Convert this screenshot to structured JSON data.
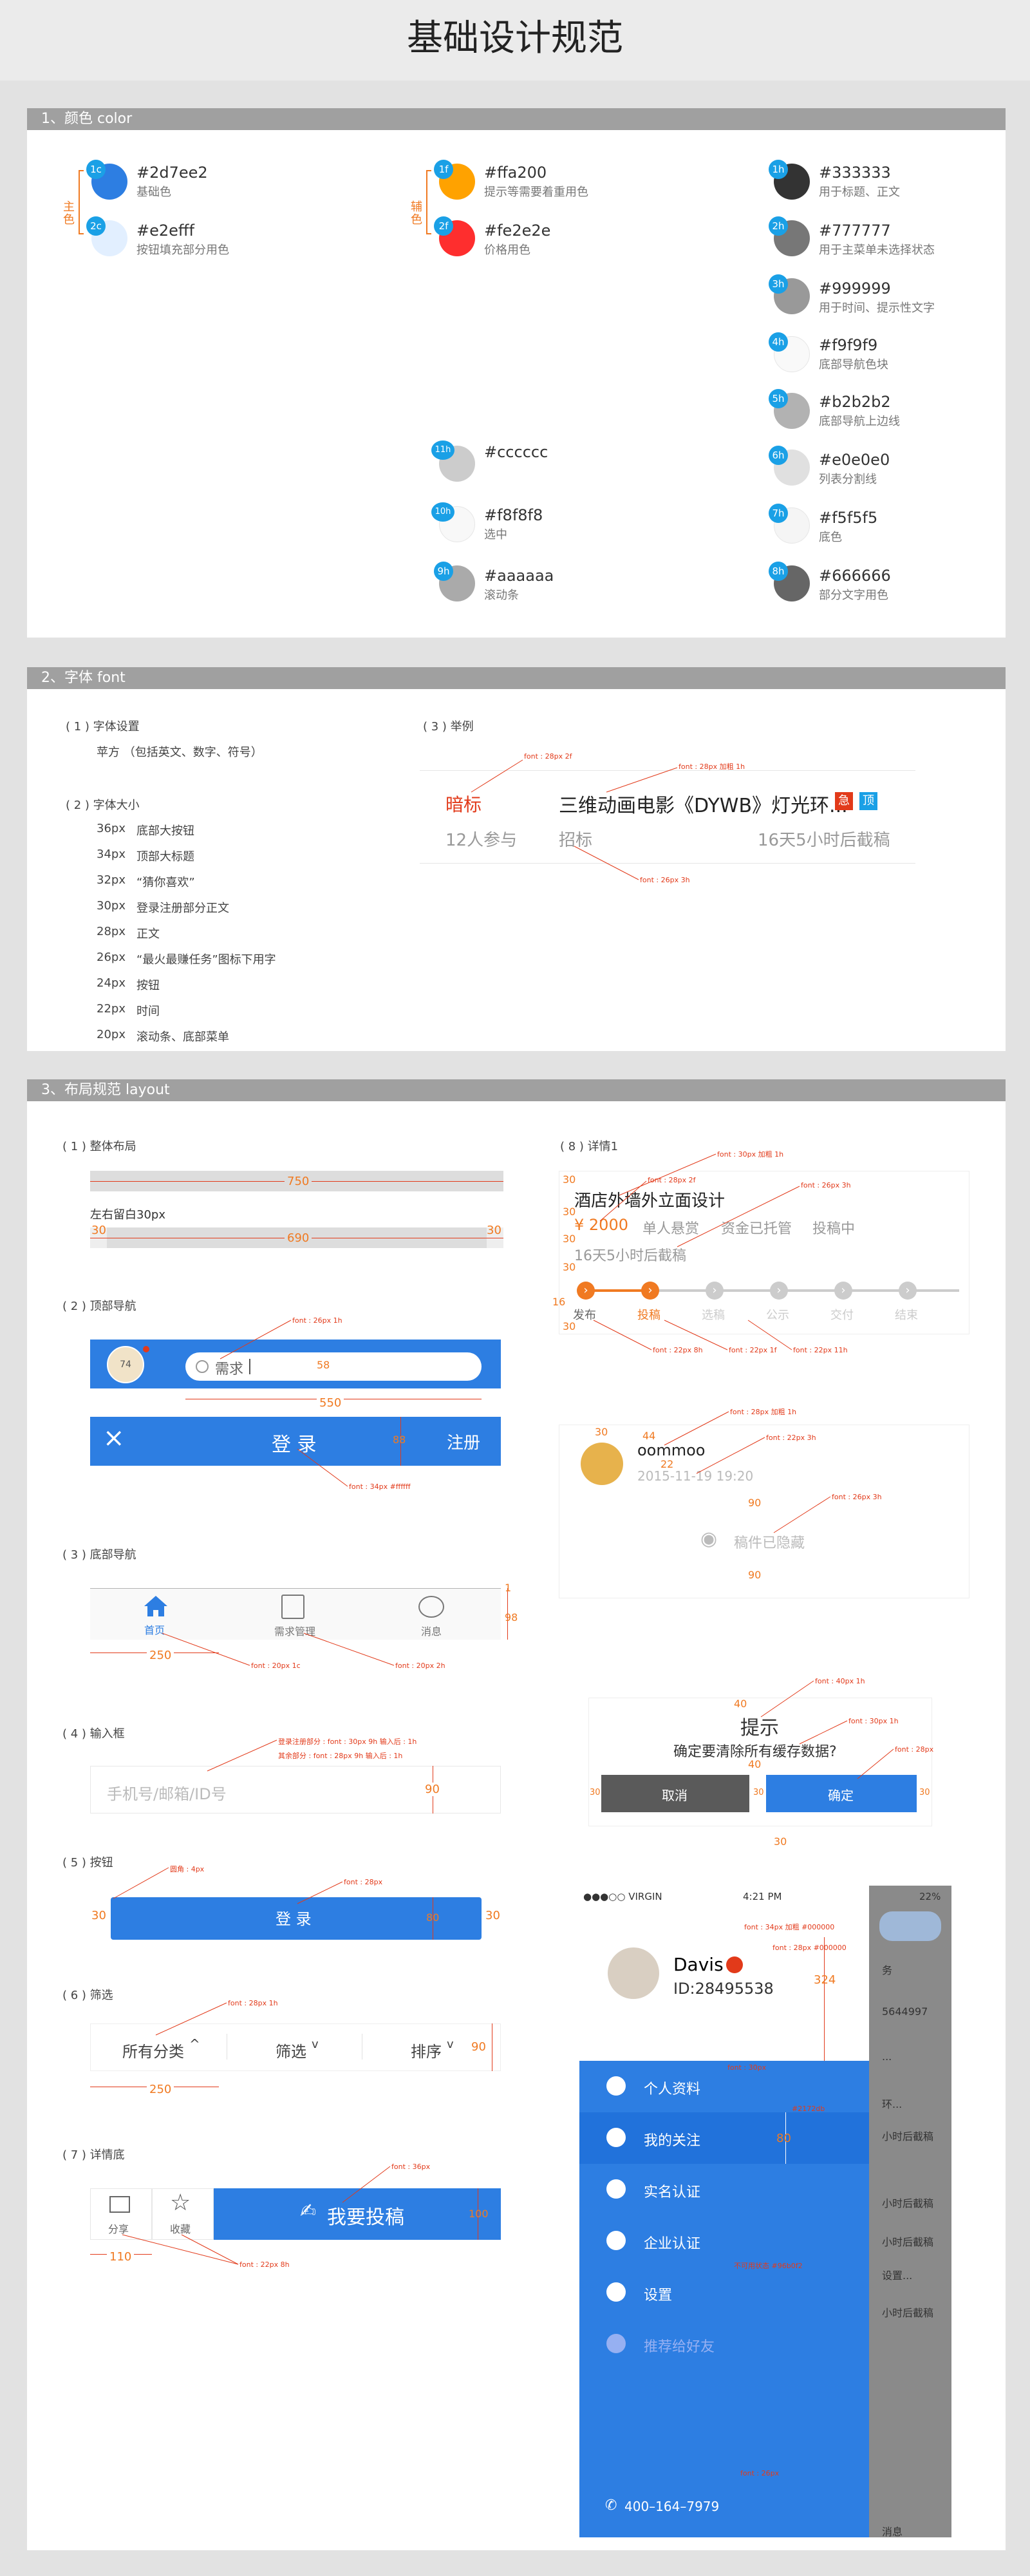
{
  "page_title": "基础设计规范",
  "sections": {
    "color": "1、颜色 color",
    "font": "2、字体 font",
    "layout": "3、布局规范 layout"
  },
  "colors": {
    "primary_label": "主色",
    "secondary_label": "辅色",
    "c1": {
      "id": "1c",
      "hex": "#2d7ee2",
      "desc": "基础色"
    },
    "c2": {
      "id": "2c",
      "hex": "#e2efff",
      "desc": "按钮填充部分用色"
    },
    "f1": {
      "id": "1f",
      "hex": "#ffa200",
      "desc": "提示等需要着重用色"
    },
    "f2": {
      "id": "2f",
      "hex": "#fe2e2e",
      "desc": "价格用色"
    },
    "f11": {
      "id": "11h",
      "hex": "#cccccc",
      "desc": ""
    },
    "f10": {
      "id": "10h",
      "hex": "#f8f8f8",
      "desc": "选中"
    },
    "f9": {
      "id": "9h",
      "hex": "#aaaaaa",
      "desc": "滚动条"
    },
    "h1": {
      "id": "1h",
      "hex": "#333333",
      "desc": "用于标题、正文"
    },
    "h2": {
      "id": "2h",
      "hex": "#777777",
      "desc": "用于主菜单未选择状态"
    },
    "h3": {
      "id": "3h",
      "hex": "#999999",
      "desc": "用于时间、提示性文字"
    },
    "h4": {
      "id": "4h",
      "hex": "#f9f9f9",
      "desc": "底部导航色块"
    },
    "h5": {
      "id": "5h",
      "hex": "#b2b2b2",
      "desc": "底部导航上边线"
    },
    "h6": {
      "id": "6h",
      "hex": "#e0e0e0",
      "desc": "列表分割线"
    },
    "h7": {
      "id": "7h",
      "hex": "#f5f5f5",
      "desc": "底色"
    },
    "h8": {
      "id": "8h",
      "hex": "#666666",
      "desc": "部分文字用色"
    }
  },
  "font": {
    "setting_title": "( 1 ) 字体设置",
    "setting_value": "苹方 （包括英文、数字、符号）",
    "size_title": "( 2 ) 字体大小",
    "sizes": [
      {
        "size": "36px",
        "use": "底部大按钮"
      },
      {
        "size": "34px",
        "use": "顶部大标题"
      },
      {
        "size": "32px",
        "use": "“猜你喜欢”"
      },
      {
        "size": "30px",
        "use": "登录注册部分正文"
      },
      {
        "size": "28px",
        "use": "正文"
      },
      {
        "size": "26px",
        "use": "“最火最赚任务”图标下用字"
      },
      {
        "size": "24px",
        "use": "按钮"
      },
      {
        "size": "22px",
        "use": "时间"
      },
      {
        "size": "20px",
        "use": "滚动条、底部菜单"
      }
    ],
    "example_title": "( 3 ) 举例",
    "ex_tag": "暗标",
    "ex_title": "三维动画电影《DYWB》灯光环...",
    "ex_urgent": "急",
    "ex_top": "顶",
    "ex_people": "12人参与",
    "ex_status": "招标",
    "ex_time": "16天5小时后截稿",
    "note1": "font : 28px  2f",
    "note2": "font : 28px 加粗 1h",
    "note3": "font : 26px 3h"
  },
  "layout": {
    "l1": "( 1 ) 整体布局",
    "w750": "750",
    "margin_txt": "左右留白30px",
    "w30": "30",
    "w690": "690",
    "l2": "( 2 ) 顶部导航",
    "nav_note": "font : 26px 1h",
    "search_text": "需求",
    "h58": "58",
    "w550": "550",
    "login": "登 录",
    "register": "注册",
    "h88": "88",
    "nav_note2": "font : 34px #ffffff",
    "l3": "( 3 ) 底部导航",
    "tab_home": "首页",
    "tab_demand": "需求管理",
    "tab_msg": "消息",
    "d1": "1",
    "d98": "98",
    "d250": "250",
    "tab_note1": "font : 20px 1c",
    "tab_note2": "font : 20px 2h",
    "l4": "( 4 ) 输入框",
    "input_note1": "登录注册部分 : font : 30px 9h   输入后 : 1h",
    "input_note2": "其余部分 : font : 28px 9h   输入后 : 1h",
    "input_ph": "手机号/邮箱/ID号",
    "d90": "90",
    "l5": "( 5 ) 按钮",
    "radius_note": "圆角 : 4px",
    "btn_note": "font : 28px",
    "btn_login": "登 录",
    "d80": "80",
    "l6": "( 6 ) 筛选",
    "filter_note": "font : 28px  1h",
    "filter_all": "所有分类",
    "filter_sel": "筛选",
    "filter_sort": "排序",
    "l7": "( 7 ) 详情底",
    "bottom_note": "font : 36px",
    "share": "分享",
    "fav": "收藏",
    "submit": "我要投稿",
    "d100": "100",
    "d110": "110",
    "bottom_note2": "font : 22px  8h",
    "l8": "( 8 ) 详情1",
    "p_title": "酒店外墙外立面设计",
    "p_price": "¥ 2000",
    "p_type": "单人悬赏",
    "p_escrow": "资金已托管",
    "p_state": "投稿中",
    "p_deadline": "16天5小时后截稿",
    "p_note1": "font : 30px 加粗 1h",
    "p_note2": "font : 28px 2f",
    "p_note3": "font : 26px 3h",
    "steps": [
      "发布",
      "投稿",
      "选稿",
      "公示",
      "交付",
      "结束"
    ],
    "step_note1": "font : 22px 8h",
    "step_note2": "font : 22px 1f",
    "step_note3": "font : 22px 11h",
    "d16": "16",
    "u_name": "oommoo",
    "u_date": "2015-11-19  19:20",
    "u_hidden": "稿件已隐藏",
    "d44": "44",
    "d22": "22",
    "d40": "40",
    "u_note1": "font : 28px 加粗 1h",
    "u_note2": "font : 22px 3h",
    "u_note3": "font : 26px 3h",
    "dlg_title": "提示",
    "dlg_msg": "确定要清除所有缓存数据?",
    "dlg_cancel": "取消",
    "dlg_ok": "确定",
    "dlg_note1": "font : 40px 1h",
    "dlg_note2": "font : 30px 1h",
    "dlg_note3": "font : 28px",
    "status_carrier": "●●●○○ VIRGIN",
    "status_time": "4:21 PM",
    "status_batt": "22%",
    "user_name": "Davis",
    "user_id": "ID:28495538",
    "d324": "324",
    "user_note1": "font : 34px 加粗 #000000",
    "user_note2": "font : 28px #000000",
    "menu": [
      "个人资料",
      "我的关注",
      "实名认证",
      "企业认证",
      "设置",
      "推荐给好友"
    ],
    "menu_note": "font : 30px",
    "sel_note": "#2172db",
    "dis_note": "不可用状态 #96b0f2",
    "phone": "400–164–7979",
    "phone_note": "font : 26px",
    "bg_peek": [
      "务",
      "5644997",
      "...",
      "环...",
      "小时后截稿",
      "小时后截稿",
      "小时后截稿",
      "设置...",
      "小时后截稿",
      "消息"
    ]
  }
}
